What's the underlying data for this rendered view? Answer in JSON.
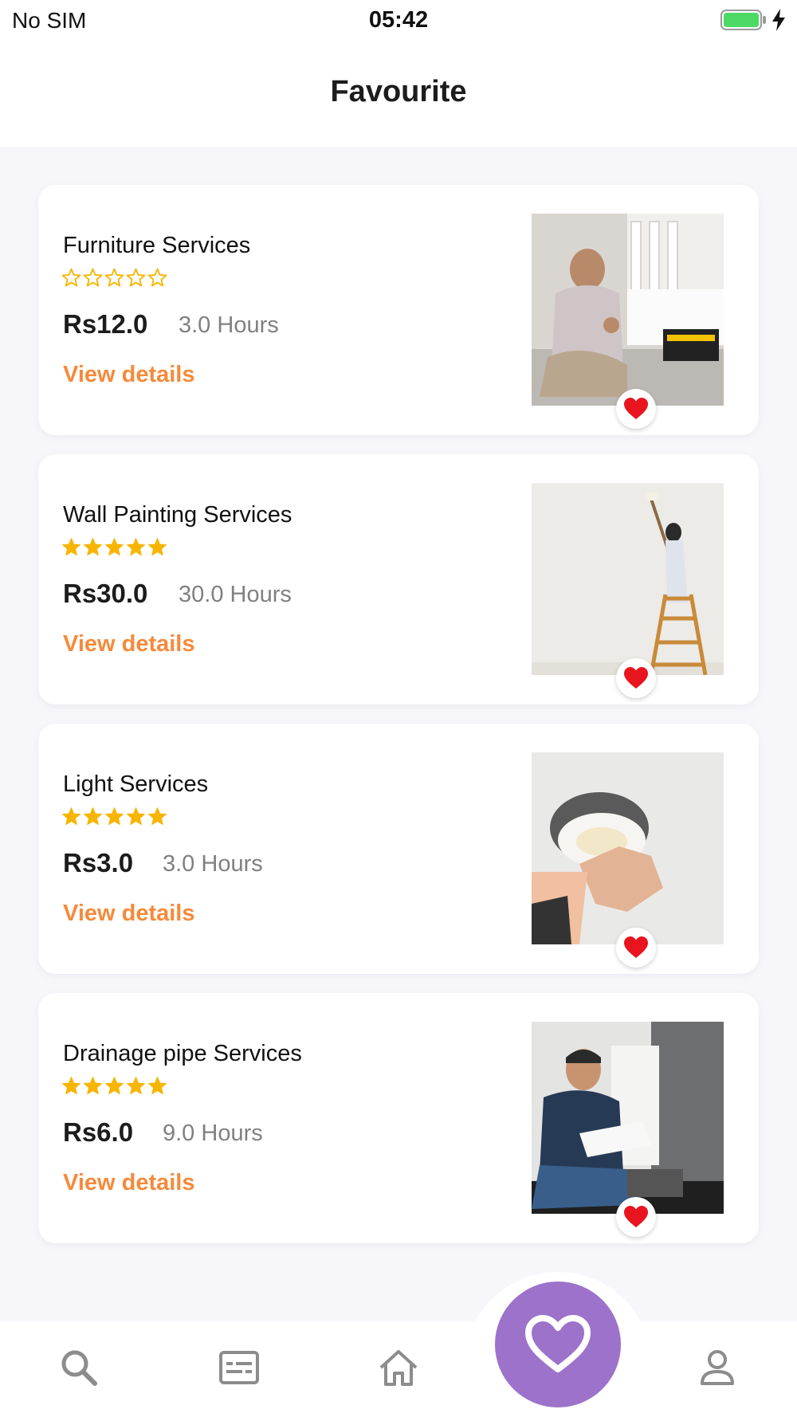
{
  "status_bar": {
    "carrier": "No SIM",
    "time": "05:42",
    "battery_color": "#4cd964"
  },
  "header": {
    "title": "Favourite"
  },
  "colors": {
    "accent_orange": "#f58a3b",
    "star_yellow": "#f7b500",
    "heart_red": "#e8141e",
    "nav_active_purple": "#9c72cb",
    "nav_icon_gray": "#8c8c8c"
  },
  "services": [
    {
      "name": "Furniture Services",
      "rating": 0,
      "rating_max": 5,
      "price": "Rs12.0",
      "duration": "3.0 Hours",
      "action": "View details",
      "image": "furniture-photo",
      "favourite": true
    },
    {
      "name": "Wall Painting Services",
      "rating": 5,
      "rating_max": 5,
      "price": "Rs30.0",
      "duration": "30.0 Hours",
      "action": "View details",
      "image": "wall-painting-photo",
      "favourite": true
    },
    {
      "name": "Light Services",
      "rating": 5,
      "rating_max": 5,
      "price": "Rs3.0",
      "duration": "3.0 Hours",
      "action": "View details",
      "image": "light-fixture-photo",
      "favourite": true
    },
    {
      "name": "Drainage pipe Services",
      "rating": 5,
      "rating_max": 5,
      "price": "Rs6.0",
      "duration": "9.0 Hours",
      "action": "View details",
      "image": "plumber-photo",
      "favourite": true
    }
  ],
  "bottom_nav": {
    "items": [
      "search-icon",
      "listings-icon",
      "home-icon",
      "heart-icon",
      "profile-icon"
    ],
    "active": "heart-icon"
  }
}
